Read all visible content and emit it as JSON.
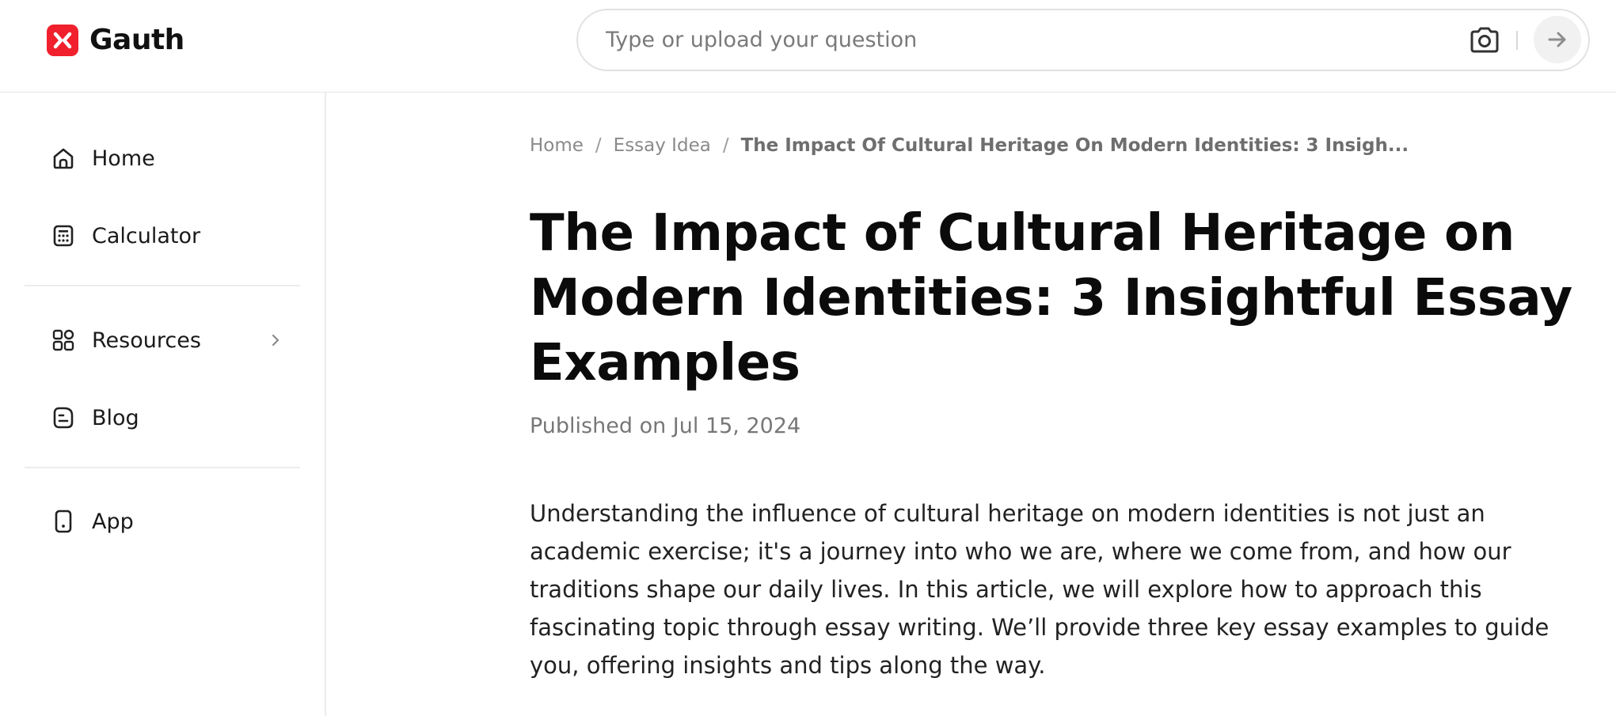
{
  "brand": {
    "name": "Gauth",
    "accent": "#f0202d"
  },
  "search": {
    "placeholder": "Type or upload your question"
  },
  "sidebar": {
    "items": [
      {
        "label": "Home",
        "icon": "home-icon"
      },
      {
        "label": "Calculator",
        "icon": "calculator-icon"
      },
      {
        "label": "Resources",
        "icon": "grid-icon"
      },
      {
        "label": "Blog",
        "icon": "blog-icon"
      },
      {
        "label": "App",
        "icon": "phone-icon"
      }
    ]
  },
  "breadcrumb": {
    "home": "Home",
    "category": "Essay Idea",
    "current": "The Impact Of Cultural Heritage On Modern Identities: 3 Insigh..."
  },
  "article": {
    "title": "The Impact of Cultural Heritage on Modern Identities: 3 Insightful Essay Examples",
    "published": "Published on Jul 15, 2024",
    "intro": "Understanding the influence of cultural heritage on modern identities is not just an academic exercise; it's a journey into who we are, where we come from, and how our traditions shape our daily lives. In this article, we will explore how to approach this fascinating topic through essay writing. We’ll provide three key essay examples to guide you, offering insights and tips along the way."
  }
}
